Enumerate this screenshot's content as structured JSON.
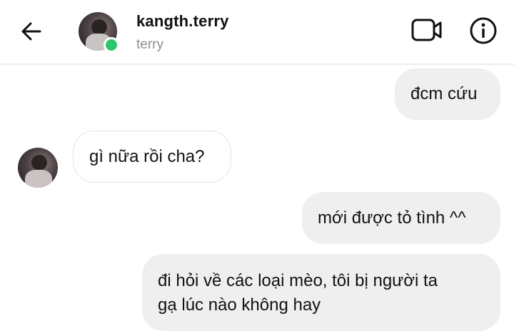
{
  "header": {
    "username": "kangth.terry",
    "subname": "terry"
  },
  "icons": {
    "back": "arrow-left-icon",
    "video": "video-camera-icon",
    "info": "info-icon"
  },
  "colors": {
    "online": "#2ec66b",
    "outgoing_bubble": "#efefef",
    "subtext": "#8e8e8e"
  },
  "messages": [
    {
      "direction": "outgoing",
      "text": "đcm cứu"
    },
    {
      "direction": "incoming",
      "text": "gì nữa rồi cha?"
    },
    {
      "direction": "outgoing",
      "text": "mới được tỏ tình ^^"
    },
    {
      "direction": "outgoing",
      "lines": [
        "đi hỏi về các loại mèo, tôi bị người ta",
        "gạ lúc nào không hay"
      ]
    }
  ]
}
